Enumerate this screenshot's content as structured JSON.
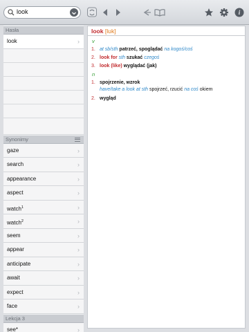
{
  "search": {
    "value": "look"
  },
  "toolbar": {
    "icons": [
      "search-icon",
      "clear-icon",
      "sync-icon",
      "back-icon",
      "forward-icon",
      "history-icon",
      "book-icon",
      "star-icon",
      "gear-icon",
      "info-icon"
    ]
  },
  "hasla": {
    "header": "Hasła",
    "items": [
      {
        "label": "look"
      }
    ]
  },
  "synonimy": {
    "header": "Synonimy",
    "items": [
      {
        "label": "gaze",
        "sup": ""
      },
      {
        "label": "search",
        "sup": ""
      },
      {
        "label": "appearance",
        "sup": ""
      },
      {
        "label": "aspect",
        "sup": ""
      },
      {
        "label": "watch",
        "sup": "1"
      },
      {
        "label": "watch",
        "sup": "2"
      },
      {
        "label": "seem",
        "sup": ""
      },
      {
        "label": "appear",
        "sup": ""
      },
      {
        "label": "anticipate",
        "sup": ""
      },
      {
        "label": "await",
        "sup": ""
      },
      {
        "label": "expect",
        "sup": ""
      },
      {
        "label": "face",
        "sup": ""
      }
    ]
  },
  "lekcja": {
    "header": "Lekcja 3",
    "items": [
      {
        "label": "see*"
      }
    ]
  },
  "entry": {
    "headword": "look",
    "pron": "[lʊk]",
    "pos_verb": "v",
    "s1_num": "1.",
    "s1_pre": "at sb/sth",
    "s1_tr": "patrzeć, spoglądać",
    "s1_post": "na kogoś/coś",
    "s2_num": "2.",
    "s2_kw": "look for",
    "s2_mid": "sth",
    "s2_tr": "szukać",
    "s2_post": "czegoś",
    "s3_num": "3.",
    "s3_kw": "look (like)",
    "s3_tr": "wyglądać (jak)",
    "pos_noun": "n",
    "n1_num": "1.",
    "n1_tr": "spojrzenie, wzrok",
    "n1_ex_a": "have/take a look at sth",
    "n1_ex_b": "spojrzeć, rzucić",
    "n1_ex_c": "na coś",
    "n1_ex_d": "okiem",
    "n2_num": "2.",
    "n2_tr": "wygląd"
  },
  "colors": {
    "headword": "#c0282b",
    "pron": "#e07a1a",
    "pos": "#2e9a2e",
    "gloss": "#2e88c9"
  }
}
